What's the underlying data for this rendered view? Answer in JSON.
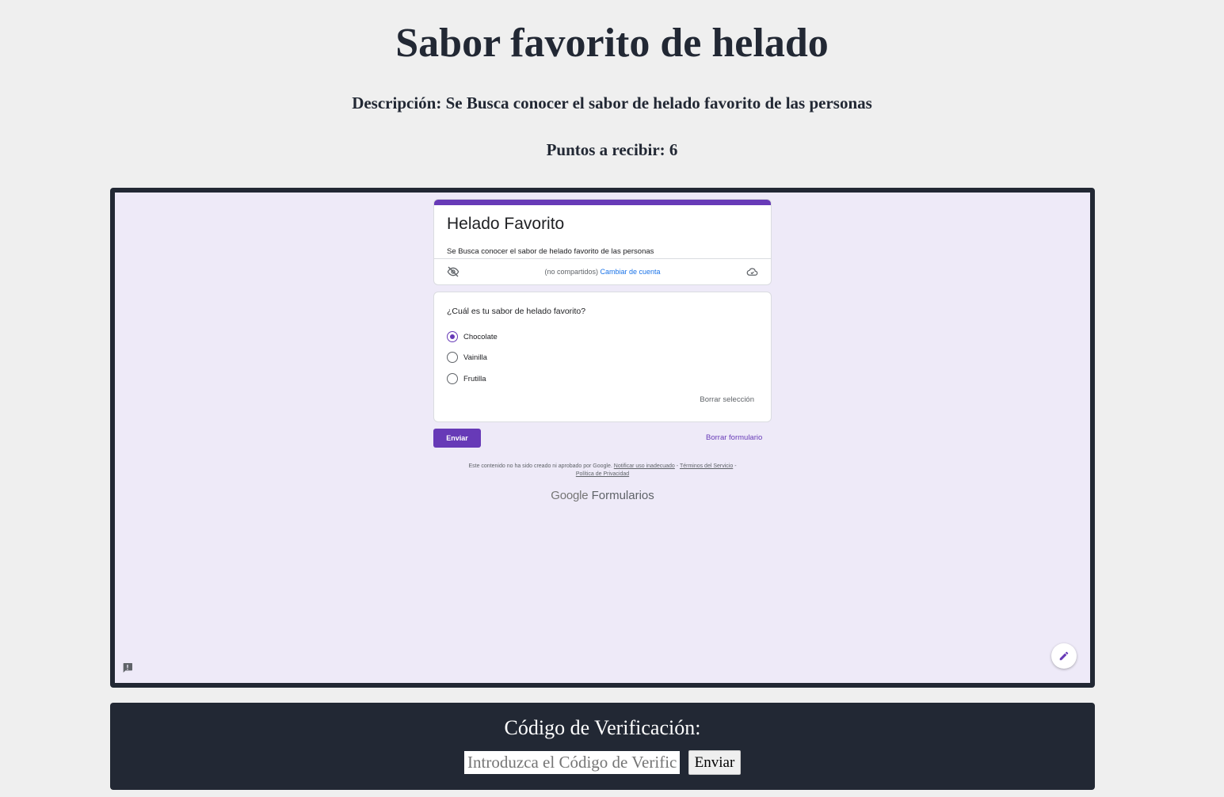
{
  "page": {
    "title": "Sabor favorito de helado",
    "description": "Descripción: Se Busca conocer el sabor de helado favorito de las personas",
    "points": "Puntos a recibir: 6"
  },
  "form": {
    "accent_color": "#673ab7",
    "title": "Helado Favorito",
    "description": "Se Busca conocer el sabor de helado favorito de las personas",
    "account": {
      "status": "(no compartidos)",
      "switch_link": "Cambiar de cuenta"
    },
    "question": {
      "title": "¿Cuál es tu sabor de helado favorito?",
      "options": [
        {
          "label": "Chocolate",
          "selected": true
        },
        {
          "label": "Vainilla",
          "selected": false
        },
        {
          "label": "Frutilla",
          "selected": false
        }
      ],
      "clear_selection": "Borrar selección"
    },
    "submit_label": "Enviar",
    "clear_form_label": "Borrar formulario",
    "disclaimer": {
      "text": "Este contenido no ha sido creado ni aprobado por Google.",
      "report_link": "Notificar uso inadecuado",
      "sep1": " - ",
      "terms_link": "Términos del Servicio",
      "sep2": " - ",
      "privacy_link": "Política de Privacidad"
    },
    "logo": {
      "brand": "Google",
      "product": "Formularios"
    }
  },
  "verification": {
    "label": "Código de Verificación:",
    "input_placeholder": "Introduzca el Código de Verificación",
    "submit_label": "Enviar"
  }
}
